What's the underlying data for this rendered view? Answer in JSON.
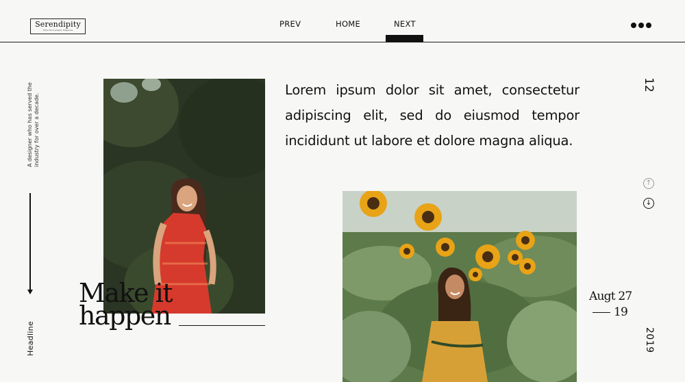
{
  "brand": {
    "name": "Serendipity",
    "tagline": "Style Photography Magazine"
  },
  "nav": {
    "prev": "PREV",
    "home": "HOME",
    "next": "NEXT",
    "active": "NEXT"
  },
  "menu_icon": "more-dots-icon",
  "side": {
    "note": "A designer who has served the industry for over a decade.",
    "headline": "Headline"
  },
  "feature": {
    "title_line1": "Make it",
    "title_line2": "happen",
    "paragraph": "Lorem ipsum dolor sit amet, consectetur adipiscing elit, sed do eiusmod tempor incididunt ut labore et dolore magna aliqua."
  },
  "pagination": {
    "page_number": "12",
    "scroll_up_icon": "arrow-up-circle-icon",
    "scroll_down_icon": "arrow-down-circle-icon"
  },
  "date": {
    "month_day": "Augt 27",
    "year_short": "19",
    "year_full": "2019"
  },
  "colors": {
    "background": "#f7f7f6",
    "text": "#111111",
    "dress": "#d63a2c",
    "foliage": "#2f3a26",
    "sunflower": "#e8a316"
  }
}
